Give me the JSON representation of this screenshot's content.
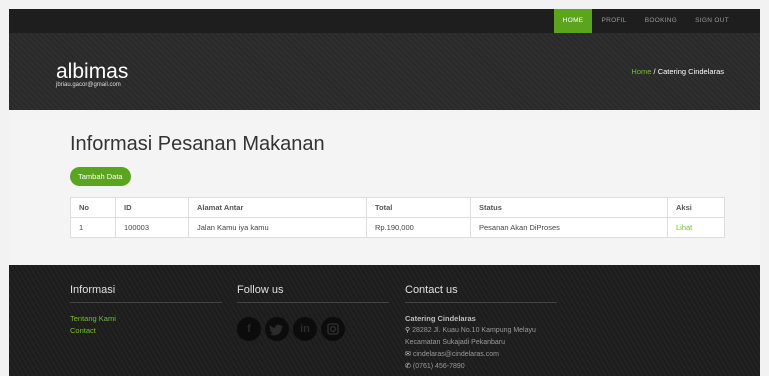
{
  "nav": {
    "items": [
      {
        "label": "HOME",
        "active": true
      },
      {
        "label": "PROFIL",
        "active": false
      },
      {
        "label": "BOOKING",
        "active": false
      },
      {
        "label": "SIGN OUT",
        "active": false
      }
    ]
  },
  "header": {
    "brand": "albimas",
    "email": "jbriau.gacor@gmail.com",
    "breadcrumb": {
      "home": "Home",
      "separator": " / ",
      "current": "Catering Cindelaras"
    }
  },
  "main": {
    "title": "Informasi Pesanan Makanan",
    "add_button": "Tambah Data",
    "table": {
      "headers": [
        "No",
        "ID",
        "Alamat Antar",
        "Total",
        "Status",
        "Aksi"
      ],
      "rows": [
        [
          "1",
          "100003",
          "Jalan Kamu iya kamu",
          "Rp.190,000",
          "Pesanan Akan DiProses",
          "Lihat"
        ]
      ]
    }
  },
  "footer": {
    "info": {
      "heading": "Informasi",
      "links": [
        "Tentang Kami",
        "Contact"
      ]
    },
    "follow": {
      "heading": "Follow us",
      "icons": [
        "facebook-icon",
        "twitter-icon",
        "linkedin-icon",
        "instagram-icon"
      ]
    },
    "contact": {
      "heading": "Contact us",
      "name": "Catering Cindelaras",
      "address1": "28282 Jl. Kuau No.10 Kampung Melayu",
      "address2": "Kecamatan Sukajadi Pekanbaru",
      "email": "cindelaras@cindelaras.com",
      "phone": "(0761) 456-7890"
    }
  },
  "colors": {
    "accent": "#5aa51d",
    "link": "#6fc12b",
    "dark": "#1e1e1e"
  }
}
